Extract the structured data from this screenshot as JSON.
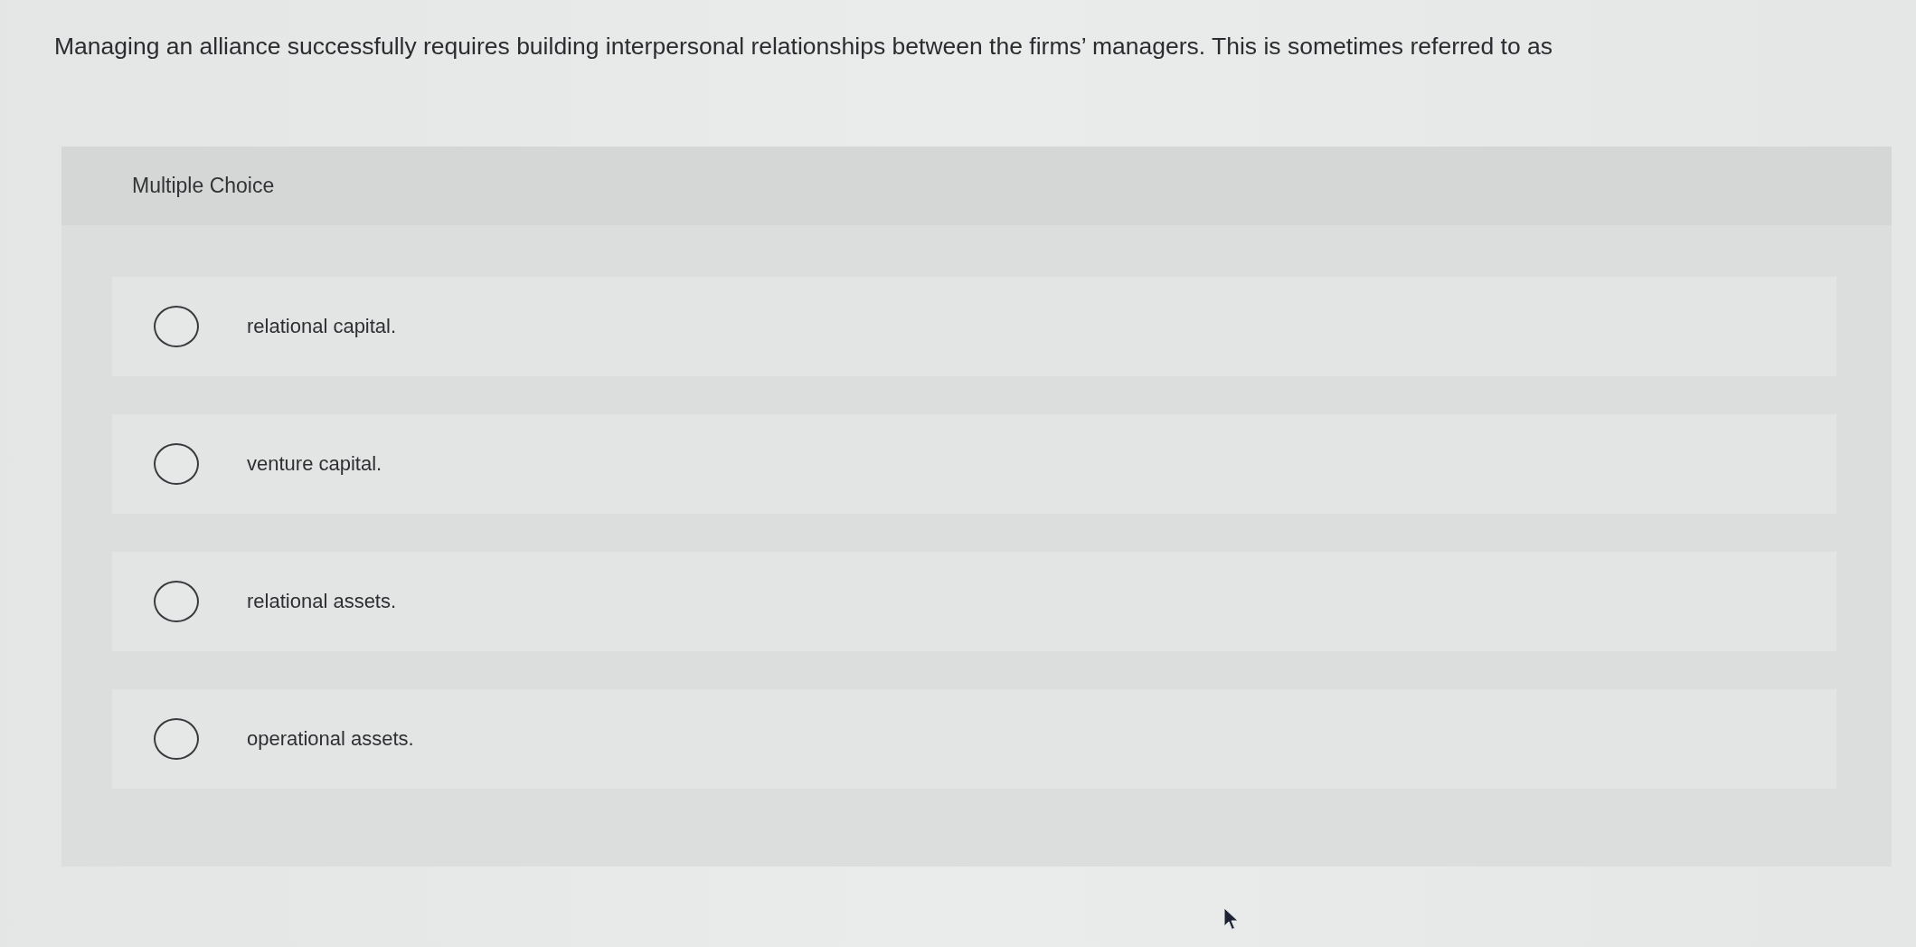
{
  "question": {
    "text": "Managing an alliance successfully requires building interpersonal relationships between the firms’ managers. This is sometimes referred to as"
  },
  "answer_panel": {
    "title": "Multiple Choice",
    "options": [
      {
        "label": "relational capital.",
        "selected": false
      },
      {
        "label": "venture capital.",
        "selected": false
      },
      {
        "label": "relational assets.",
        "selected": false
      },
      {
        "label": "operational assets.",
        "selected": false
      }
    ]
  }
}
